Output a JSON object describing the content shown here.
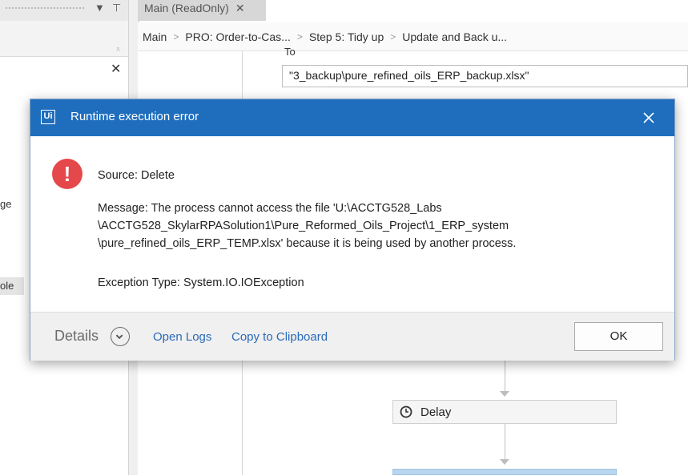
{
  "left_panel": {
    "cut_label_1": "ge",
    "cut_label_2": "ole"
  },
  "tab": {
    "title": "Main (ReadOnly)",
    "close_glyph": "✕"
  },
  "breadcrumb": [
    "Main",
    "PRO: Order-to-Cas...",
    "Step 5: Tidy up",
    "Update and Back u..."
  ],
  "canvas": {
    "io_label": "To",
    "path_value": "\"3_backup\\pure_refined_oils_ERP_backup.xlsx\"",
    "activity_label": "Delay"
  },
  "dialog": {
    "logo_text": "Ui",
    "title": "Runtime execution error",
    "source": "Source: Delete",
    "message_line1": "Message: The process cannot access the file 'U:\\ACCTG528_Labs",
    "message_line2": "\\ACCTG528_SkylarRPASolution1\\Pure_Reformed_Oils_Project\\1_ERP_system",
    "message_line3": "\\pure_refined_oils_ERP_TEMP.xlsx' because it is being used by another process.",
    "exception": "Exception Type: System.IO.IOException",
    "details_label": "Details",
    "open_logs": "Open Logs",
    "copy_clipboard": "Copy to Clipboard",
    "ok": "OK"
  },
  "colors": {
    "title_bar": "#1e6ebd",
    "error": "#e5484a",
    "link": "#2a6bb8"
  }
}
